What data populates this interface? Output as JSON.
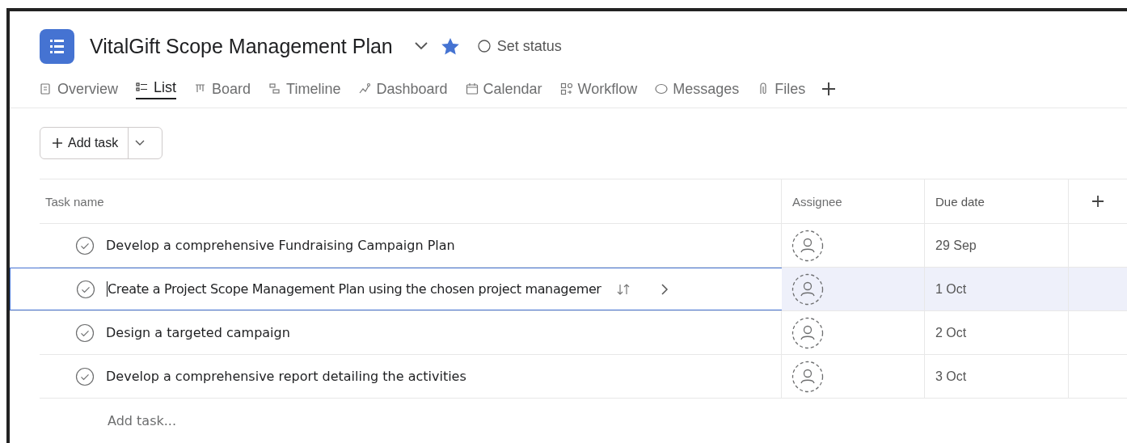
{
  "project": {
    "title": "VitalGift Scope Management Plan",
    "starred": true,
    "status": "Set status"
  },
  "tabs": [
    {
      "label": "Overview",
      "kind": "overview",
      "selected": false
    },
    {
      "label": "List",
      "kind": "list",
      "selected": true
    },
    {
      "label": "Board",
      "kind": "board",
      "selected": false
    },
    {
      "label": "Timeline",
      "kind": "timeline",
      "selected": false
    },
    {
      "label": "Dashboard",
      "kind": "dashboard",
      "selected": false
    },
    {
      "label": "Calendar",
      "kind": "calendar",
      "selected": false
    },
    {
      "label": "Workflow",
      "kind": "workflow",
      "selected": false
    },
    {
      "label": "Messages",
      "kind": "messages",
      "selected": false
    },
    {
      "label": "Files",
      "kind": "files",
      "selected": false
    }
  ],
  "toolbar": {
    "add_button": "Add task"
  },
  "table": {
    "columns": [
      "Task name",
      "Assignee",
      "Due date"
    ],
    "rows": [
      {
        "name": "Develop a comprehensive Fundraising Campaign Plan",
        "due": "29 Sep",
        "selected": false
      },
      {
        "name": "Create a Project Scope Management Plan using the chosen project managemer",
        "due": "1 Oct",
        "selected": true
      },
      {
        "name": "Design a targeted campaign",
        "due": "2 Oct",
        "selected": false
      },
      {
        "name": "Develop a comprehensive report detailing the activities",
        "due": "3 Oct",
        "selected": false
      }
    ],
    "add_row": "Add task..."
  }
}
